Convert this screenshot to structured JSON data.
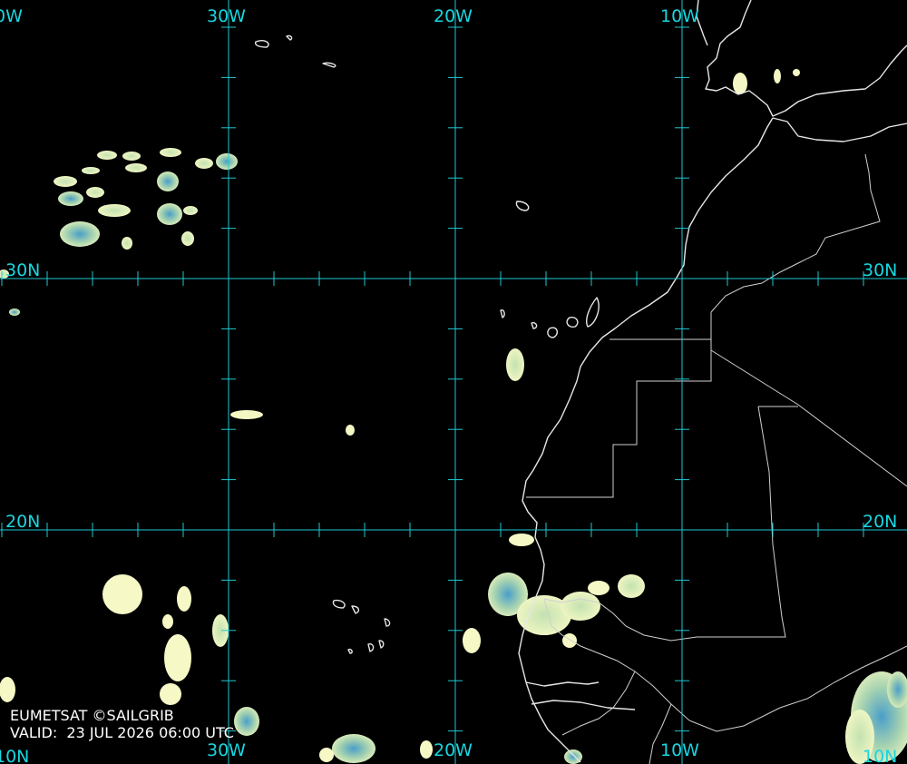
{
  "credit": {
    "source": "EUMETSAT ©SAILGRIB",
    "valid": "VALID:  23 JUL 2026 06:00 UTC"
  },
  "grid_labels": {
    "top_40w": "0W",
    "top_30w": "30W",
    "top_20w": "20W",
    "top_10w": "10W",
    "bottom_40w": "10N",
    "bottom_30w": "30W",
    "bottom_20w": "20W",
    "bottom_10w": "10W",
    "bottom_right": "10N",
    "left_30n": "30N",
    "right_30n": "30N",
    "left_20n": "20N",
    "right_20n": "20N"
  },
  "colors": {
    "grid": "#1ec8d2",
    "label": "#19d6e0",
    "coastline": "#e6e6e6",
    "cloud_light": "#f6f9c4",
    "cloud_mid": "#b9dca0",
    "cloud_deep": "#3f98c8"
  }
}
